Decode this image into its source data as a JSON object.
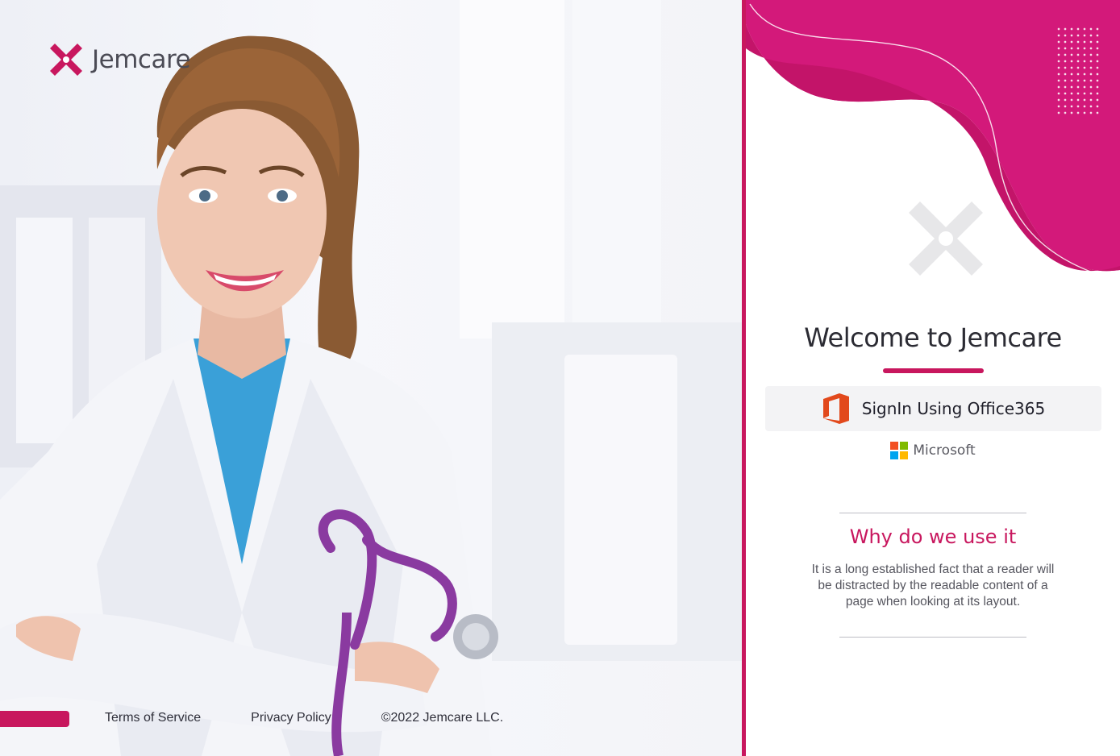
{
  "brand": {
    "name": "Jemcare",
    "accent_color": "#c8175e"
  },
  "footer": {
    "links": [
      "Terms of Service",
      "Privacy Policy"
    ],
    "copyright": "©2022 Jemcare LLC."
  },
  "welcome": {
    "title": "Welcome to Jemcare"
  },
  "signin": {
    "label": "SignIn Using Office365",
    "icon": "office365-icon"
  },
  "microsoft": {
    "label": "Microsoft",
    "icon": "microsoft-logo-icon"
  },
  "info": {
    "title": "Why do we use it",
    "text": "It is a long established fact that a reader will be distracted by the readable content of a page when looking at its layout."
  }
}
